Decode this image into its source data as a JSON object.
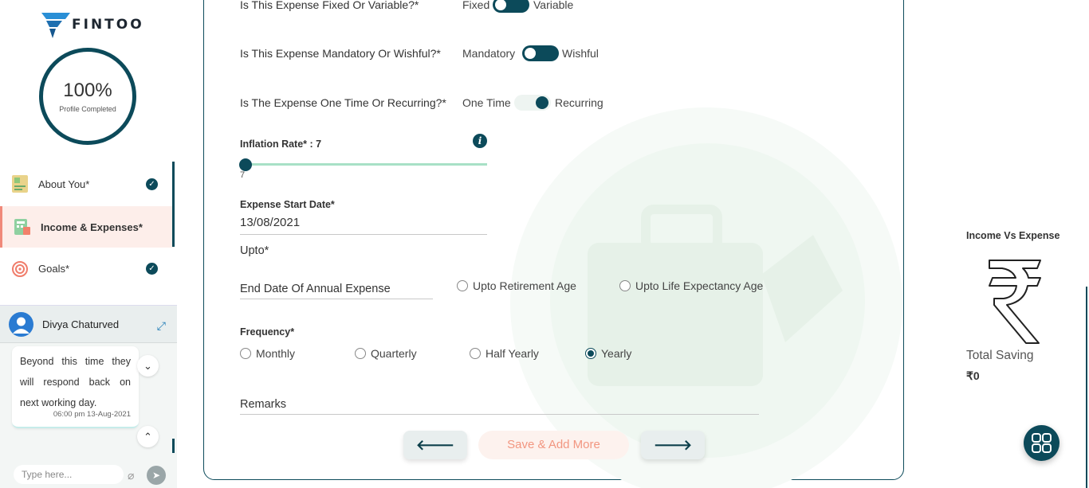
{
  "brand": {
    "name": "FINTOO",
    "accent": "#0c4a5a"
  },
  "profile": {
    "percent": "100%",
    "label": "Profile Completed"
  },
  "menu": [
    {
      "label": "About You*",
      "icon": "about-you-icon",
      "done": true
    },
    {
      "label": "Income & Expenses*",
      "icon": "income-expenses-icon",
      "active": true
    },
    {
      "label": "Goals*",
      "icon": "target-icon",
      "done": true
    }
  ],
  "chat": {
    "agent_name": "Divya Chaturved",
    "message": "Beyond this time they will respond back on next working day.",
    "time": "06:00 pm 13-Aug-2021",
    "input_placeholder": "Type here..."
  },
  "form": {
    "q_fixed": "Is This Expense Fixed Or Variable?*",
    "fixed_left": "Fixed",
    "fixed_right": "Variable",
    "q_mandatory": "Is This Expense Mandatory Or Wishful?*",
    "mandatory_left": "Mandatory",
    "mandatory_right": "Wishful",
    "q_recurring": "Is The Expense One Time Or Recurring?*",
    "recurring_left": "One Time",
    "recurring_right": "Recurring",
    "inflation_label": "Inflation Rate* : 7",
    "inflation_value": "7",
    "start_date_label": "Expense Start Date*",
    "start_date_value": "13/08/2021",
    "upto_label": "Upto*",
    "end_date_placeholder": "End Date Of Annual Expense",
    "upto_options": [
      "Upto Retirement Age",
      "Upto Life Expectancy Age"
    ],
    "frequency_label": "Frequency*",
    "frequency_options": [
      "Monthly",
      "Quarterly",
      "Half Yearly",
      "Yearly"
    ],
    "frequency_selected": "Yearly",
    "remarks_placeholder": "Remarks",
    "save_label": "Save & Add More",
    "prev_arrow": "🡐",
    "next_arrow": "🡒"
  },
  "summary": {
    "title": "Income Vs Expense",
    "total_label": "Total Saving",
    "total_value": "₹0"
  }
}
